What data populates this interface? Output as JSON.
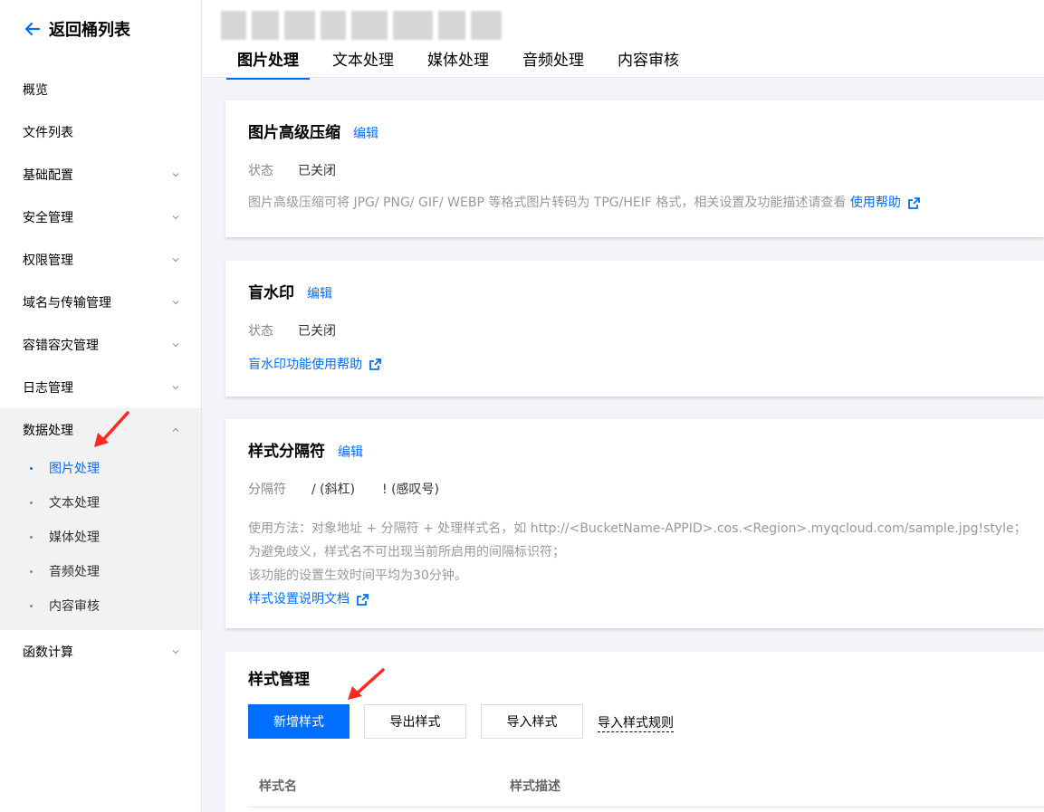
{
  "sidebar": {
    "back_label": "返回桶列表",
    "items": [
      {
        "label": "概览",
        "has_chevron": false
      },
      {
        "label": "文件列表",
        "has_chevron": false
      },
      {
        "label": "基础配置",
        "has_chevron": true
      },
      {
        "label": "安全管理",
        "has_chevron": true
      },
      {
        "label": "权限管理",
        "has_chevron": true
      },
      {
        "label": "域名与传输管理",
        "has_chevron": true
      },
      {
        "label": "容错容灾管理",
        "has_chevron": true
      },
      {
        "label": "日志管理",
        "has_chevron": true
      }
    ],
    "expanded_group": {
      "label": "数据处理",
      "children": [
        "图片处理",
        "文本处理",
        "媒体处理",
        "音频处理",
        "内容审核"
      ],
      "active_child": "图片处理"
    },
    "trailing_item": {
      "label": "函数计算",
      "has_chevron": true
    }
  },
  "header": {
    "tabs": [
      "图片处理",
      "文本处理",
      "媒体处理",
      "音频处理",
      "内容审核"
    ],
    "active_tab": "图片处理"
  },
  "compress_card": {
    "title": "图片高级压缩",
    "edit": "编辑",
    "status_label": "状态",
    "status_value": "已关闭",
    "desc": "图片高级压缩可将 JPG/ PNG/ GIF/ WEBP 等格式图片转码为 TPG/HEIF 格式，相关设置及功能描述请查看",
    "help_link": "使用帮助"
  },
  "watermark_card": {
    "title": "盲水印",
    "edit": "编辑",
    "status_label": "状态",
    "status_value": "已关闭",
    "help_link": "盲水印功能使用帮助"
  },
  "separator_card": {
    "title": "样式分隔符",
    "edit": "编辑",
    "sep_label": "分隔符",
    "sep_values": [
      "/ (斜杠)",
      "! (感叹号)"
    ],
    "usage_lines": [
      "使用方法：对象地址 + 分隔符 + 处理样式名，如 http://<BucketName-APPID>.cos.<Region>.myqcloud.com/sample.jpg!style；",
      "为避免歧义，样式名不可出现当前所启用的间隔标识符；",
      "该功能的设置生效时间平均为30分钟。"
    ],
    "doc_link": "样式设置说明文档"
  },
  "style_card": {
    "title": "样式管理",
    "buttons": {
      "add": "新增样式",
      "export": "导出样式",
      "import": "导入样式"
    },
    "rules_link": "导入样式规则",
    "columns": [
      "样式名",
      "样式描述"
    ]
  },
  "colors": {
    "accent": "#006eff",
    "annotation_arrow": "#ff2a1f"
  }
}
